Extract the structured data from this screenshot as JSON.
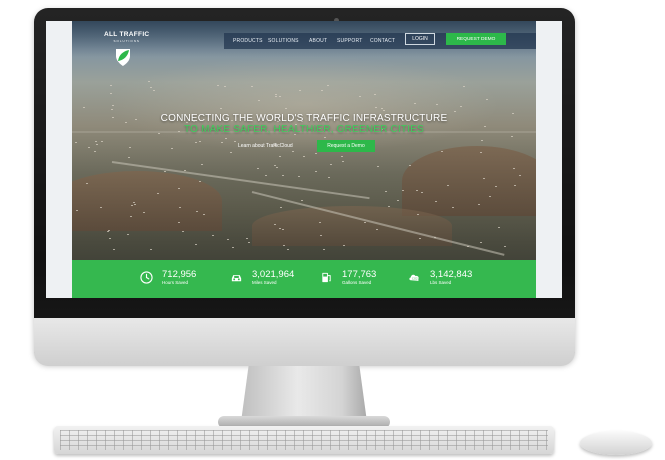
{
  "brand": {
    "name": "ALL TRAFFIC",
    "tagline": "SOLUTIONS"
  },
  "nav": {
    "items": [
      "PRODUCTS",
      "SOLUTIONS",
      "ABOUT",
      "SUPPORT",
      "CONTACT"
    ],
    "login_label": "LOGIN",
    "demo_label": "REQUEST DEMO"
  },
  "hero": {
    "headline": "CONNECTING THE WORLD'S TRAFFIC INFRASTRUCTURE",
    "subheadline": "TO MAKE SAFER, HEALTHIER, GREENER CITIES",
    "learn_link": "Learn about TrafficCloud",
    "cta_label": "Request a Demo"
  },
  "stats": [
    {
      "value": "712,956",
      "label": "Hours Saved",
      "icon": "clock-icon"
    },
    {
      "value": "3,021,964",
      "label": "Miles Saved",
      "icon": "car-icon"
    },
    {
      "value": "177,763",
      "label": "Gallons Saved",
      "icon": "fuel-pump-icon"
    },
    {
      "value": "3,142,843",
      "label": "Lbs Saved",
      "icon": "co2-icon"
    }
  ],
  "colors": {
    "accent_green": "#35b84f",
    "nav_blue": "#233750",
    "bezel": "#111111"
  }
}
